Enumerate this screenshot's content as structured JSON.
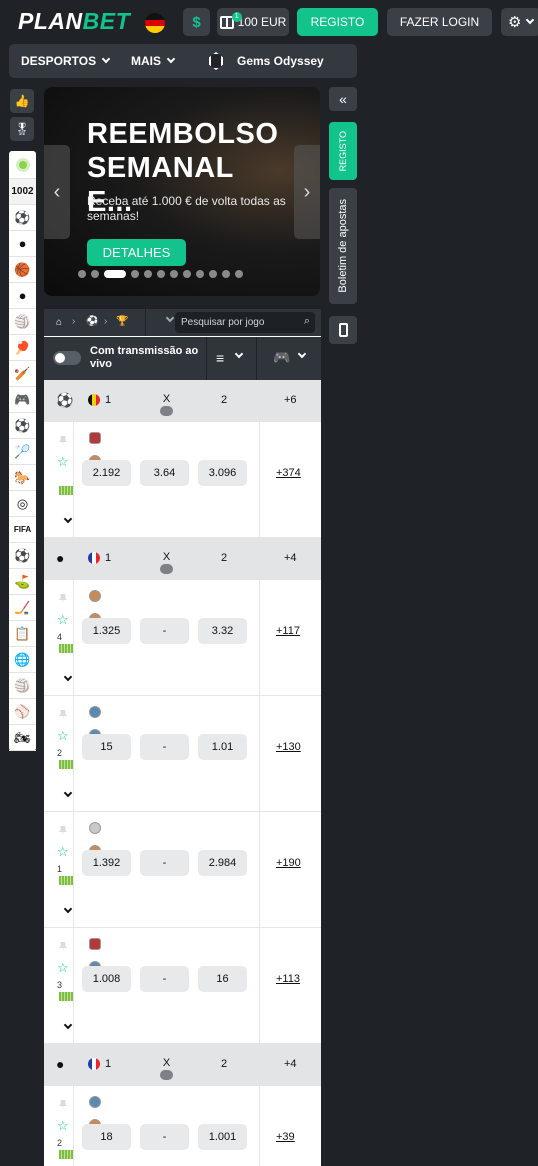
{
  "header": {
    "logo_plan": "PLAN",
    "logo_bet": "BET",
    "dollar": "$",
    "bonus_badge": "1",
    "bonus_amount": "100 EUR",
    "register": "REGISTO",
    "login": "FAZER LOGIN"
  },
  "nav": {
    "sports": "DESPORTOS",
    "more": "MAIS",
    "game": "Gems Odyssey"
  },
  "sidebar": {
    "live_count": "1002",
    "sports": [
      "⚽",
      "●",
      "🏀",
      "●",
      "🏐",
      "🏓",
      "🏏",
      "🎮",
      "⚽",
      "🏸",
      "🐎",
      "◎",
      "FIFA",
      "⚽",
      "⛳",
      "🏒",
      "📋",
      "🌐",
      "🏐",
      "⚾",
      "🏍"
    ]
  },
  "banner": {
    "title": "REEMBOLSO SEMANAL E...",
    "subtitle": "Receba até 1.000 € de volta todas as semanas!",
    "cta": "DETALHES",
    "dots_total": 12,
    "active_dot": 2
  },
  "right_sidebar": {
    "register": "REGISTO",
    "betslip": "Boletim de apostas"
  },
  "filters": {
    "search_placeholder": "Pesquisar por jogo",
    "live_stream": "Com transmissão ao vivo"
  },
  "leagues": [
    {
      "sport": "football",
      "flag": [
        "#111111",
        "#f5d20a",
        "#e8262d"
      ],
      "col1": "1",
      "colx": "X",
      "col2": "2",
      "more": "+6",
      "matches": [
        {
          "odds": [
            "2.192",
            "3.64",
            "3.096"
          ],
          "more": "+374",
          "score": ""
        }
      ]
    },
    {
      "sport": "tennis",
      "flag": [
        "#1f3fa5",
        "#ffffff",
        "#e8262d"
      ],
      "col1": "1",
      "colx": "X",
      "col2": "2",
      "more": "+4",
      "matches": [
        {
          "odds": [
            "1.325",
            "-",
            "3.32"
          ],
          "more": "+117",
          "score": "4"
        },
        {
          "odds": [
            "15",
            "-",
            "1.01"
          ],
          "more": "+130",
          "score": "2"
        },
        {
          "odds": [
            "1.392",
            "-",
            "2.984"
          ],
          "more": "+190",
          "score": "1"
        },
        {
          "odds": [
            "1.008",
            "-",
            "16"
          ],
          "more": "+113",
          "score": "3"
        }
      ]
    },
    {
      "sport": "tennis",
      "flag": [
        "#1f3fa5",
        "#ffffff",
        "#e8262d"
      ],
      "col1": "1",
      "colx": "X",
      "col2": "2",
      "more": "+4",
      "matches": [
        {
          "odds": [
            "18",
            "-",
            "1.001"
          ],
          "more": "+39",
          "score": "2"
        }
      ]
    }
  ],
  "colors": {
    "accent": "#12c38c",
    "background": "#1f2327",
    "panel": "#33393f"
  }
}
